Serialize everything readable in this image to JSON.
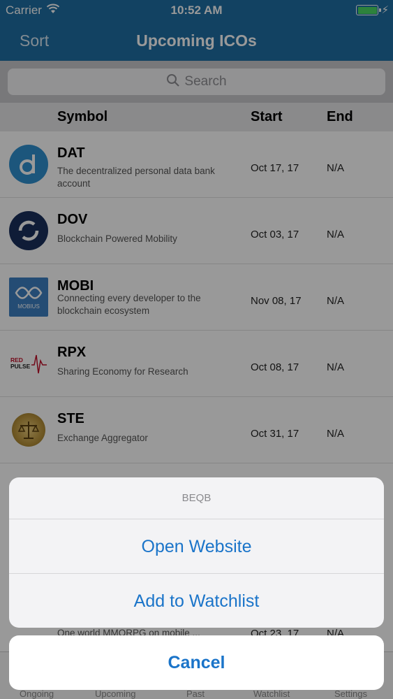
{
  "status": {
    "carrier": "Carrier",
    "time": "10:52 AM"
  },
  "nav": {
    "sort_label": "Sort",
    "title": "Upcoming ICOs"
  },
  "search": {
    "placeholder": "Search"
  },
  "columns": {
    "symbol": "Symbol",
    "start": "Start",
    "end": "End"
  },
  "rows": [
    {
      "symbol": "DAT",
      "desc": "The decentralized personal data bank account",
      "start": "Oct 17, 17",
      "end": "N/A"
    },
    {
      "symbol": "DOV",
      "desc": "Blockchain Powered Mobility",
      "start": "Oct 03, 17",
      "end": "N/A"
    },
    {
      "symbol": "MOBI",
      "desc": "Connecting every developer to the blockchain ecosystem",
      "start": "Nov 08, 17",
      "end": "N/A",
      "logo_text": "MOBIUS"
    },
    {
      "symbol": "RPX",
      "desc": "Sharing Economy for Research",
      "start": "Oct 08, 17",
      "end": "N/A",
      "logo_text_1": "RED",
      "logo_text_2": "PULSE"
    },
    {
      "symbol": "STE",
      "desc": "Exchange Aggregator",
      "start": "Oct 31, 17",
      "end": "N/A"
    }
  ],
  "partial_row": {
    "desc": "One world MMORPG on mobile ...",
    "start": "Oct 23, 17",
    "end": "N/A"
  },
  "tabs": [
    "Ongoing",
    "Upcoming",
    "Past",
    "Watchlist",
    "Settings"
  ],
  "action_sheet": {
    "title": "BEQB",
    "open_website": "Open Website",
    "add_watchlist": "Add to Watchlist",
    "cancel": "Cancel"
  },
  "colors": {
    "nav_bg": "#1f6fa3",
    "action_blue": "#1a74c9",
    "battery": "#4cd964"
  }
}
